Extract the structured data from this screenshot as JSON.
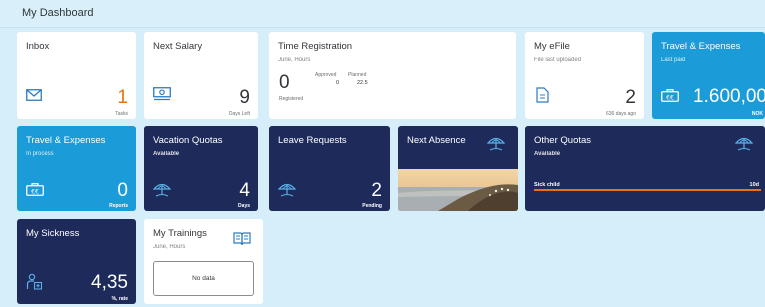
{
  "header": {
    "title": "My Dashboard"
  },
  "tiles": {
    "inbox": {
      "title": "Inbox",
      "value": "1",
      "unit": "Tasks",
      "icon": "envelope-icon"
    },
    "next_salary": {
      "title": "Next Salary",
      "value": "9",
      "unit": "Days Left",
      "icon": "money-bills-icon"
    },
    "time_registration": {
      "title": "Time Registration",
      "subtitle": "June, Hours",
      "value": "0",
      "value_label": "Registered",
      "approved_label": "Approved",
      "approved_value": "0",
      "planned_label": "Planned",
      "planned_value": "22.5"
    },
    "my_efile": {
      "title": "My eFile",
      "subtitle": "File last uploaded",
      "value": "2",
      "unit": "636 days ago",
      "icon": "document-icon"
    },
    "travel_expenses_paid": {
      "title": "Travel & Expenses",
      "subtitle": "Last paid",
      "value": "1.600,00",
      "unit": "NOK",
      "icon": "travel-expense-icon"
    },
    "travel_expenses_process": {
      "title": "Travel & Expenses",
      "subtitle": "In process",
      "value": "0",
      "unit": "Reports",
      "icon": "travel-expense-icon"
    },
    "vacation_quotas": {
      "title": "Vacation Quotas",
      "subtitle": "Available",
      "value": "4",
      "unit": "Days",
      "icon": "beach-umbrella-icon"
    },
    "leave_requests": {
      "title": "Leave Requests",
      "value": "2",
      "unit": "Pending",
      "icon": "beach-umbrella-icon"
    },
    "next_absence": {
      "title": "Next Absence",
      "icon": "beach-umbrella-icon"
    },
    "other_quotas": {
      "title": "Other Quotas",
      "subtitle": "Available",
      "bar_label": "Sick child",
      "bar_value": "10d",
      "bar_fraction": 1.0,
      "icon": "beach-umbrella-icon"
    },
    "my_sickness": {
      "title": "My Sickness",
      "value": "4,35",
      "unit": "%, rate",
      "icon": "sick-person-icon"
    },
    "my_trainings": {
      "title": "My Trainings",
      "subtitle": "June, Hours",
      "empty_text": "No data",
      "icon": "book-icon"
    }
  },
  "colors": {
    "navy": "#1d2a5a",
    "blue": "#1b9bd7",
    "orange": "#e9730c",
    "bar": "#e9730c"
  }
}
